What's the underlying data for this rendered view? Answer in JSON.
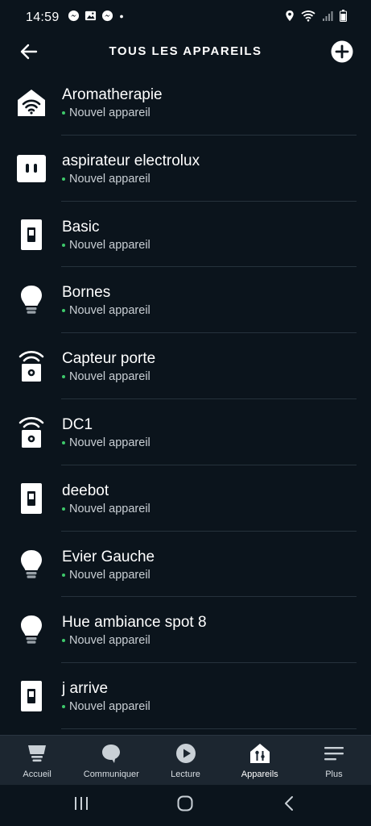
{
  "status_bar": {
    "time": "14:59"
  },
  "header": {
    "title": "TOUS LES APPAREILS"
  },
  "devices": [
    {
      "name": "Aromatherapie",
      "status": "Nouvel appareil",
      "icon": "smart-home-icon"
    },
    {
      "name": "aspirateur electrolux",
      "status": "Nouvel appareil",
      "icon": "plug-icon"
    },
    {
      "name": "Basic",
      "status": "Nouvel appareil",
      "icon": "switch-icon"
    },
    {
      "name": "Bornes",
      "status": "Nouvel appareil",
      "icon": "bulb-icon"
    },
    {
      "name": "Capteur porte",
      "status": "Nouvel appareil",
      "icon": "sensor-icon"
    },
    {
      "name": "DC1",
      "status": "Nouvel appareil",
      "icon": "sensor-icon"
    },
    {
      "name": "deebot",
      "status": "Nouvel appareil",
      "icon": "switch-icon"
    },
    {
      "name": "Evier Gauche",
      "status": "Nouvel appareil",
      "icon": "bulb-icon"
    },
    {
      "name": "Hue ambiance spot 8",
      "status": "Nouvel appareil",
      "icon": "bulb-icon"
    },
    {
      "name": "j arrive",
      "status": "Nouvel appareil",
      "icon": "switch-icon"
    }
  ],
  "bottom_nav": {
    "home": "Accueil",
    "communicate": "Communiquer",
    "play": "Lecture",
    "devices": "Appareils",
    "more": "Plus"
  },
  "colors": {
    "background": "#0b141c",
    "nav_background": "#1c2630",
    "status_dot": "#3ec96b"
  }
}
